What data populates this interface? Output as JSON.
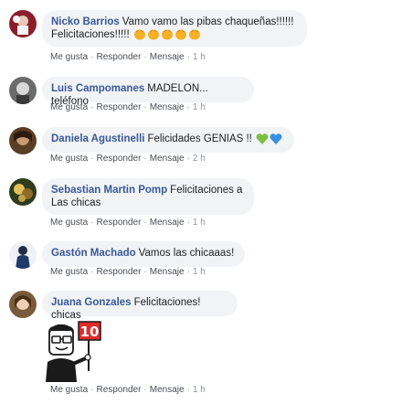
{
  "actions": {
    "like": "Me gusta",
    "reply": "Responder",
    "message": "Mensaje"
  },
  "comments": [
    {
      "author": "Nicko Barrios",
      "text_line1": "Vamo vamo las pibas chaqueñas!!!!!!",
      "text_line2": "Felicitaciones!!!!!",
      "emojis": [
        "clapping-hands",
        "clapping-hands",
        "clapping-hands",
        "clapping-hands",
        "clapping-hands"
      ],
      "time": "1 h"
    },
    {
      "author": "Luis Campomanes",
      "text": "MADELON... teléfono",
      "time": "1 h"
    },
    {
      "author": "Daniela Agustinelli",
      "text": "Felicidades GENIAS !!",
      "emojis": [
        "green-heart",
        "blue-heart"
      ],
      "time": "2 h"
    },
    {
      "author": "Sebastian Martin Pomp",
      "text_line1": "Felicitaciones a",
      "text_line2": "Las chicas",
      "time": "1 h"
    },
    {
      "author": "Gastón Machado",
      "text": "Vamos las chicaaas!",
      "time": "1 h"
    },
    {
      "author": "Juana Gonzales",
      "text": "Felicitaciones! chicas",
      "sticker": {
        "icon": "score-ten-sticker",
        "sign_text": "10"
      },
      "time": "1 h"
    }
  ],
  "colors": {
    "author": "#385898",
    "bubble": "#f2f3f5",
    "meta": "#90949c"
  }
}
